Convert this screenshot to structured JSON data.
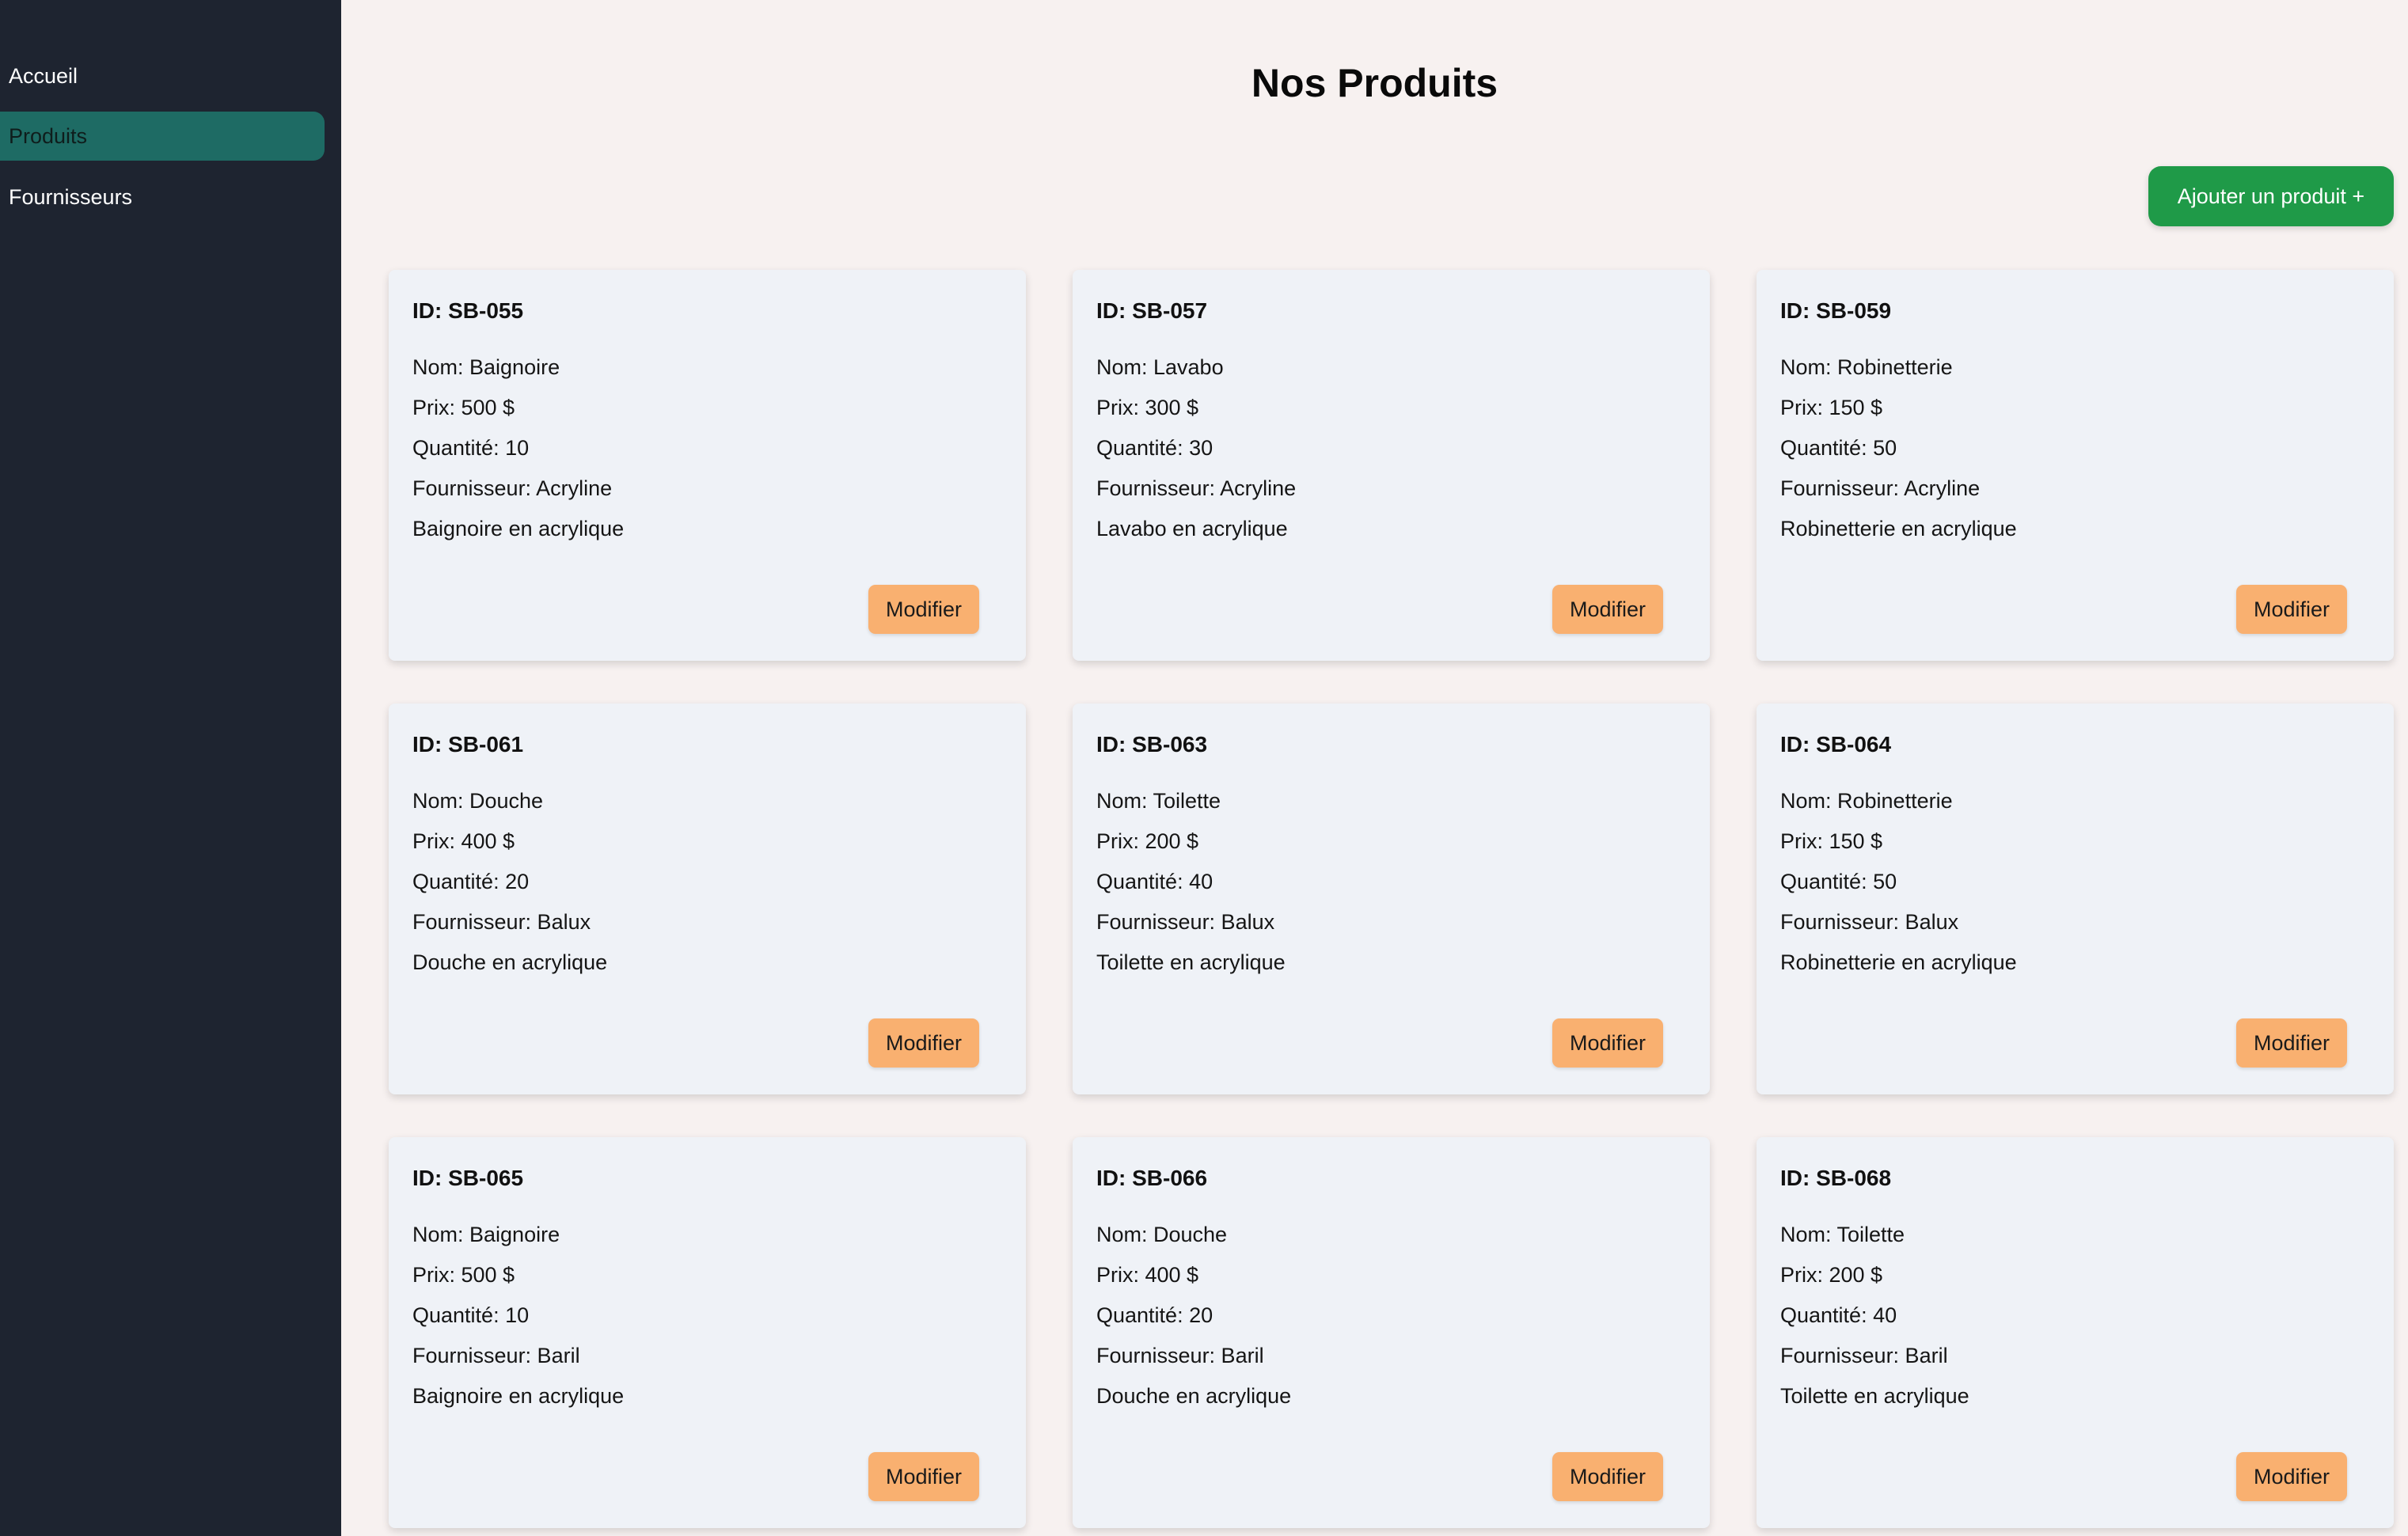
{
  "sidebar": {
    "items": [
      {
        "label": "Accueil",
        "active": false
      },
      {
        "label": "Produits",
        "active": true
      },
      {
        "label": "Fournisseurs",
        "active": false
      }
    ]
  },
  "page": {
    "title": "Nos Produits",
    "add_button": "Ajouter un produit +"
  },
  "products": [
    {
      "id": "ID: SB-055",
      "name": "Nom: Baignoire",
      "price": "Prix: 500 $",
      "quantity": "Quantité: 10",
      "supplier": "Fournisseur: Acryline",
      "description": "Baignoire en acrylique",
      "edit": "Modifier"
    },
    {
      "id": "ID: SB-057",
      "name": "Nom: Lavabo",
      "price": "Prix: 300 $",
      "quantity": "Quantité: 30",
      "supplier": "Fournisseur: Acryline",
      "description": "Lavabo en acrylique",
      "edit": "Modifier"
    },
    {
      "id": "ID: SB-059",
      "name": "Nom: Robinetterie",
      "price": "Prix: 150 $",
      "quantity": "Quantité: 50",
      "supplier": "Fournisseur: Acryline",
      "description": "Robinetterie en acrylique",
      "edit": "Modifier"
    },
    {
      "id": "ID: SB-061",
      "name": "Nom: Douche",
      "price": "Prix: 400 $",
      "quantity": "Quantité: 20",
      "supplier": "Fournisseur: Balux",
      "description": "Douche en acrylique",
      "edit": "Modifier"
    },
    {
      "id": "ID: SB-063",
      "name": "Nom: Toilette",
      "price": "Prix: 200 $",
      "quantity": "Quantité: 40",
      "supplier": "Fournisseur: Balux",
      "description": "Toilette en acrylique",
      "edit": "Modifier"
    },
    {
      "id": "ID: SB-064",
      "name": "Nom: Robinetterie",
      "price": "Prix: 150 $",
      "quantity": "Quantité: 50",
      "supplier": "Fournisseur: Balux",
      "description": "Robinetterie en acrylique",
      "edit": "Modifier"
    },
    {
      "id": "ID: SB-065",
      "name": "Nom: Baignoire",
      "price": "Prix: 500 $",
      "quantity": "Quantité: 10",
      "supplier": "Fournisseur: Baril",
      "description": "Baignoire en acrylique",
      "edit": "Modifier"
    },
    {
      "id": "ID: SB-066",
      "name": "Nom: Douche",
      "price": "Prix: 400 $",
      "quantity": "Quantité: 20",
      "supplier": "Fournisseur: Baril",
      "description": "Douche en acrylique",
      "edit": "Modifier"
    },
    {
      "id": "ID: SB-068",
      "name": "Nom: Toilette",
      "price": "Prix: 200 $",
      "quantity": "Quantité: 40",
      "supplier": "Fournisseur: Baril",
      "description": "Toilette en acrylique",
      "edit": "Modifier"
    }
  ],
  "colors": {
    "sidebar_bg": "#1e2430",
    "active_nav": "#1e6b64",
    "page_bg": "#f7f1f0",
    "card_bg": "#eff2f7",
    "add_button": "#1f9a48",
    "edit_button": "#f9b070"
  }
}
